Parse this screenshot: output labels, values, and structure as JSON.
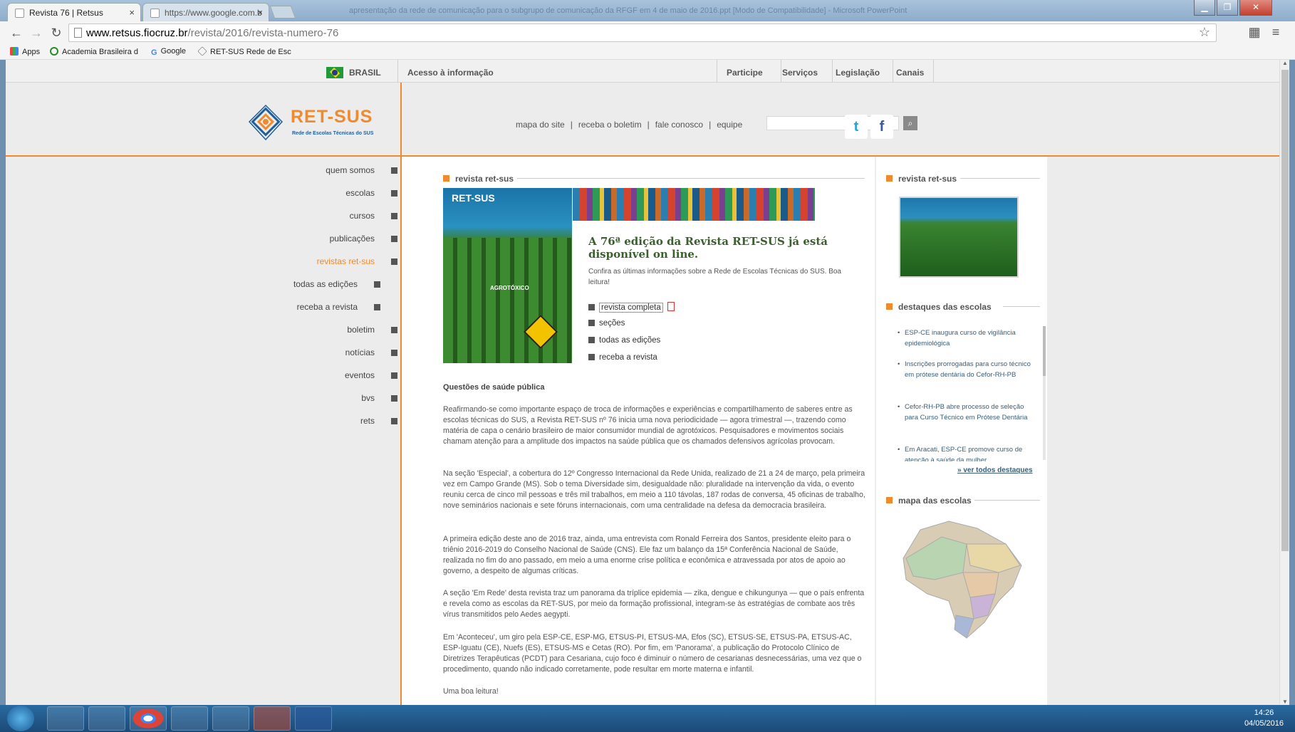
{
  "browser": {
    "tabs": [
      {
        "label": "Revista 76 | Retsus",
        "close": "×"
      },
      {
        "label": "https://www.google.com.b",
        "close": "×"
      }
    ],
    "window_title": "apresentação da rede de comunicação para o subgrupo de comunicação da RFGF em 4 de maio de 2016.ppt [Modo de Compatibilidade] - Microsoft PowerPoint",
    "window_controls": [
      "▁",
      "❐",
      "✕"
    ],
    "url_host": "www.retsus.fiocruz.br",
    "url_path": "/revista/2016/revista-numero-76",
    "bookmarks": [
      "Apps",
      "Academia Brasileira d",
      "Google",
      "RET-SUS Rede de Esc"
    ]
  },
  "gov_bar": {
    "country": "BRASIL",
    "access": "Acesso à informação",
    "links": [
      "Participe",
      "Serviços",
      "Legislação",
      "Canais"
    ]
  },
  "header": {
    "logo_name": "RET-SUS",
    "logo_tagline": "Rede de Escolas Técnicas do SUS",
    "top_links": [
      "mapa do site",
      "receba o boletim",
      "fale conosco",
      "equipe"
    ],
    "search_placeholder": "",
    "social": [
      "twitter-icon",
      "facebook-icon"
    ]
  },
  "sidebar": {
    "items": [
      {
        "label": "quem somos"
      },
      {
        "label": "escolas"
      },
      {
        "label": "cursos"
      },
      {
        "label": "publicações"
      },
      {
        "label": "revistas ret-sus",
        "active": true
      },
      {
        "label": "todas as edições",
        "sub": true
      },
      {
        "label": "receba a revista",
        "sub": true
      },
      {
        "label": "boletim"
      },
      {
        "label": "notícias"
      },
      {
        "label": "eventos"
      },
      {
        "label": "bvs"
      },
      {
        "label": "rets"
      }
    ]
  },
  "main": {
    "section_title": "revista ret-sus",
    "cover_brand": "RET-SUS",
    "cover_headline": "AGROTÓXICO",
    "lead_title": "A 76ª edição da Revista RET-SUS já está disponível on line.",
    "lead_sub": "Confira as últimas informações sobre a Rede de Escolas Técnicas do SUS. Boa leitura!",
    "links": [
      "revista completa",
      "seções",
      "todas as edições",
      "receba a revista"
    ],
    "subtitle": "Questões de saúde pública",
    "paragraphs": [
      "Reafirmando-se como importante espaço de troca de informações e experiências e compartilhamento de saberes entre as escolas técnicas do SUS, a Revista RET-SUS nº 76 inicia uma nova periodicidade — agora trimestral —, trazendo como matéria de capa o cenário brasileiro de maior consumidor mundial de agrotóxicos. Pesquisadores e movimentos sociais chamam atenção para a amplitude dos impactos na saúde pública que os chamados defensivos agrícolas provocam.",
      "Na seção 'Especial', a cobertura do 12º Congresso Internacional da Rede Unida, realizado de 21 a 24 de março, pela primeira vez em Campo Grande (MS). Sob o tema Diversidade sim, desigualdade não: pluralidade na intervenção da vida, o evento reuniu cerca de cinco mil pessoas e três mil trabalhos, em meio a 110 távolas, 187 rodas de conversa, 45 oficinas de trabalho, nove seminários nacionais e sete fóruns internacionais, com uma centralidade na defesa da democracia brasileira.",
      "A primeira edição deste ano de 2016 traz, ainda, uma entrevista com Ronald Ferreira dos Santos, presidente eleito para o triênio 2016-2019 do Conselho Nacional de Saúde (CNS). Ele faz um balanço da 15ª Conferência Nacional de Saúde, realizada no fim do ano passado, em meio a uma enorme crise política e econômica e atravessada por atos de apoio ao governo, a despeito de algumas críticas.",
      "A seção 'Em Rede' desta revista traz um panorama da tríplice epidemia — zika, dengue e chikungunya — que o país enfrenta e revela como as escolas da RET-SUS, por meio da formação profissional, integram-se às estratégias de combate aos três vírus transmitidos pelo Aedes aegypti.",
      "Em 'Aconteceu', um giro pela ESP-CE, ESP-MG, ETSUS-PI, ETSUS-MA, Efos (SC), ETSUS-SE, ETSUS-PA, ETSUS-AC, ESP-Iguatu (CE), Nuefs (ES), ETSUS-MS e Cetas (RO). Por fim, em 'Panorama', a publicação do Protocolo Clínico de Diretrizes Terapêuticas (PCDT) para Cesariana, cujo foco é diminuir o número de cesarianas desnecessárias, uma vez que o procedimento, quando não indicado corretamente, pode resultar em morte materna e infantil.",
      "Uma boa leitura!"
    ]
  },
  "right": {
    "revista_title": "revista ret-sus",
    "destaques_title": "destaques das escolas",
    "destaques": [
      "ESP-CE inaugura curso de vigilância epidemiológica",
      "Inscrições prorrogadas para curso técnico em prótese dentária do Cefor-RH-PB",
      "Cefor-RH-PB abre processo de seleção para Curso Técnico em Prótese Dentária",
      "Em Aracati, ESP-CE promove curso de atenção à saúde da mulher"
    ],
    "ver_todos": "» ver todos destaques",
    "mapa_title": "mapa das escolas"
  },
  "taskbar": {
    "time": "14:26",
    "date": "04/05/2016",
    "apps": [
      "internet-explorer-icon",
      "file-explorer-icon",
      "chrome-icon",
      "media-player-icon",
      "folder-icon",
      "powerpoint-icon",
      "word-icon"
    ]
  },
  "colors": {
    "accent": "#f08a2c",
    "lead_title": "#3b5f2f",
    "link": "#3a5f7a"
  }
}
